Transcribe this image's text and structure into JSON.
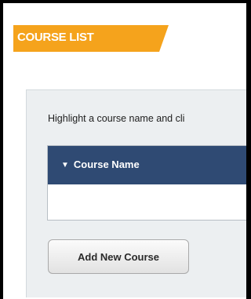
{
  "header": {
    "title": "COURSE LIST",
    "accent_color": "#f5a31c"
  },
  "panel": {
    "instruction": "Highlight a course name and cli",
    "table": {
      "columns": [
        {
          "label": "Course Name",
          "sort_icon": "triangle-down-icon"
        }
      ],
      "header_color": "#2f4a73",
      "rows": []
    },
    "add_button_label": "Add New Course"
  }
}
